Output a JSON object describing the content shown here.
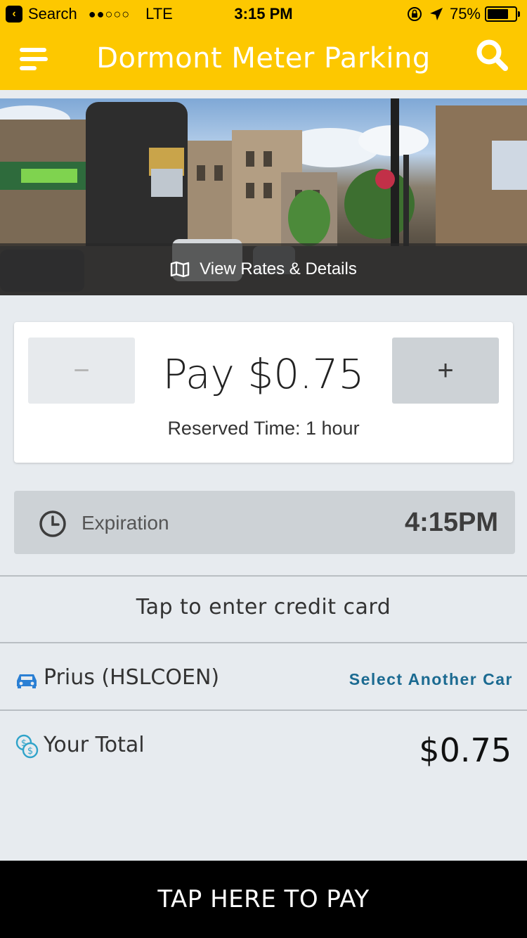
{
  "status_bar": {
    "back_label": "Search",
    "signal": "●●○○○",
    "carrier": "LTE",
    "time": "3:15 PM",
    "battery": "75%",
    "battery_level": 0.75
  },
  "navbar": {
    "title": "Dormont Meter Parking"
  },
  "hero": {
    "rates_link": "View Rates & Details"
  },
  "payment": {
    "minus_label": "−",
    "plus_label": "+",
    "amount": "Pay $0.75",
    "reserved": "Reserved Time: 1 hour"
  },
  "expiration": {
    "label": "Expiration",
    "time": "4:15PM"
  },
  "credit_card": {
    "label": "Tap to enter credit card"
  },
  "car": {
    "label": "Prius (HSLCOEN)",
    "select_label": "Select Another Car"
  },
  "total": {
    "label": "Your Total",
    "value": "$0.75"
  },
  "footer": {
    "pay_label": "TAP HERE TO PAY"
  },
  "colors": {
    "brand": "#fdc800",
    "link": "#1b6a91",
    "car_icon": "#2a7fd4",
    "money_icon": "#2fa3c9"
  }
}
